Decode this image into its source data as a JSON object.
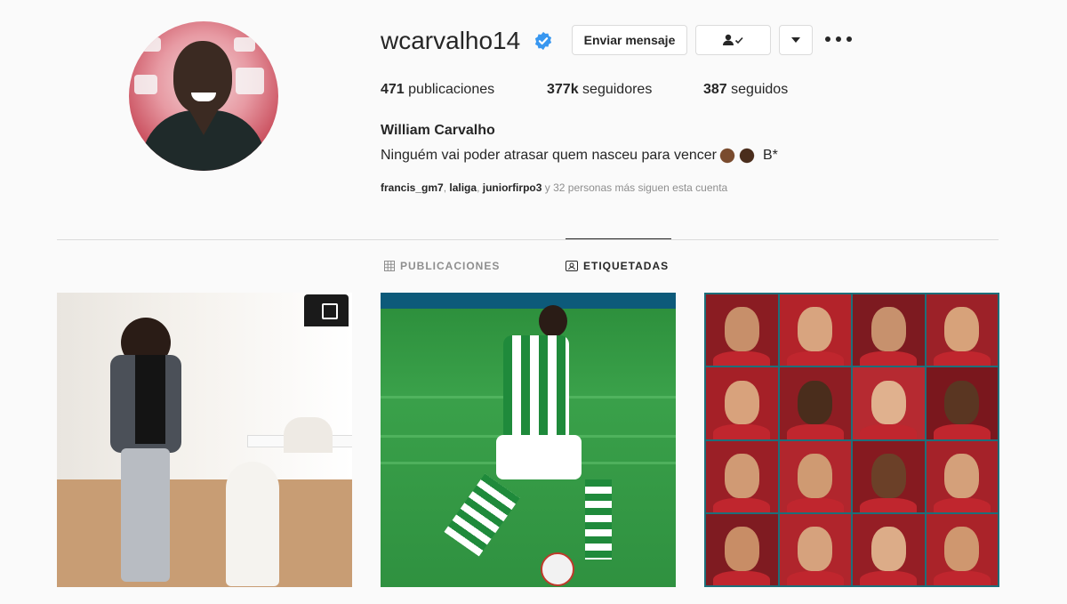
{
  "profile": {
    "username": "wcarvalho14",
    "verified": true,
    "message_button": "Enviar mensaje",
    "follow_icon": "person-check-icon",
    "dropdown_icon": "caret-down-icon",
    "more_icon": "more-options-icon",
    "stats": {
      "posts_count": "471",
      "posts_label": "publicaciones",
      "followers_count": "377k",
      "followers_label": "seguidores",
      "following_count": "387",
      "following_label": "seguidos"
    },
    "full_name": "William Carvalho",
    "bio_text": "Ninguém vai poder atrasar quem nasceu para vencer",
    "bio_suffix": "B*",
    "followed_by": {
      "user1": "francis_gm7",
      "user2": "laliga",
      "user3": "juniorfirpo3",
      "rest": "y 32 personas más siguen esta cuenta"
    }
  },
  "tabs": [
    {
      "label": "PUBLICACIONES",
      "icon": "grid-icon",
      "active": false
    },
    {
      "label": "ETIQUETADAS",
      "icon": "tagged-icon",
      "active": true
    }
  ],
  "colors": {
    "accent": "#0095f6",
    "text": "#262626",
    "muted": "#8e8e8e",
    "border": "#dbdbdb",
    "background": "#fafafa"
  }
}
